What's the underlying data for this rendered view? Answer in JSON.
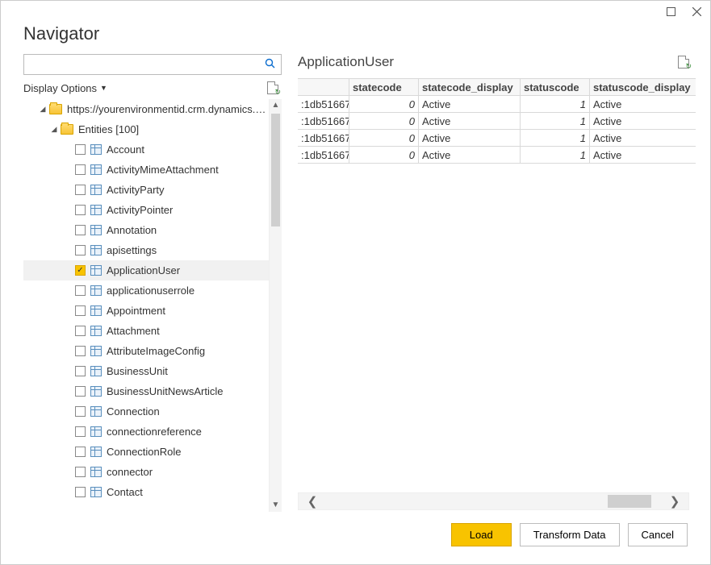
{
  "title": "Navigator",
  "displayOptions": "Display Options",
  "searchPlaceholder": "",
  "tree": {
    "root": "https://yourenvironmentid.crm.dynamics.…",
    "entitiesLabel": "Entities [100]",
    "items": [
      {
        "label": "Account",
        "checked": false
      },
      {
        "label": "ActivityMimeAttachment",
        "checked": false
      },
      {
        "label": "ActivityParty",
        "checked": false
      },
      {
        "label": "ActivityPointer",
        "checked": false
      },
      {
        "label": "Annotation",
        "checked": false
      },
      {
        "label": "apisettings",
        "checked": false
      },
      {
        "label": "ApplicationUser",
        "checked": true
      },
      {
        "label": "applicationuserrole",
        "checked": false
      },
      {
        "label": "Appointment",
        "checked": false
      },
      {
        "label": "Attachment",
        "checked": false
      },
      {
        "label": "AttributeImageConfig",
        "checked": false
      },
      {
        "label": "BusinessUnit",
        "checked": false
      },
      {
        "label": "BusinessUnitNewsArticle",
        "checked": false
      },
      {
        "label": "Connection",
        "checked": false
      },
      {
        "label": "connectionreference",
        "checked": false
      },
      {
        "label": "ConnectionRole",
        "checked": false
      },
      {
        "label": "connector",
        "checked": false
      },
      {
        "label": "Contact",
        "checked": false
      }
    ]
  },
  "preview": {
    "title": "ApplicationUser",
    "columns": [
      "",
      "statecode",
      "statecode_display",
      "statuscode",
      "statuscode_display"
    ],
    "rows": [
      {
        "c0": ":1db51667",
        "c1": "0",
        "c2": "Active",
        "c3": "1",
        "c4": "Active"
      },
      {
        "c0": ":1db51667",
        "c1": "0",
        "c2": "Active",
        "c3": "1",
        "c4": "Active"
      },
      {
        "c0": ":1db51667",
        "c1": "0",
        "c2": "Active",
        "c3": "1",
        "c4": "Active"
      },
      {
        "c0": ":1db51667",
        "c1": "0",
        "c2": "Active",
        "c3": "1",
        "c4": "Active"
      }
    ]
  },
  "buttons": {
    "load": "Load",
    "transform": "Transform Data",
    "cancel": "Cancel"
  }
}
